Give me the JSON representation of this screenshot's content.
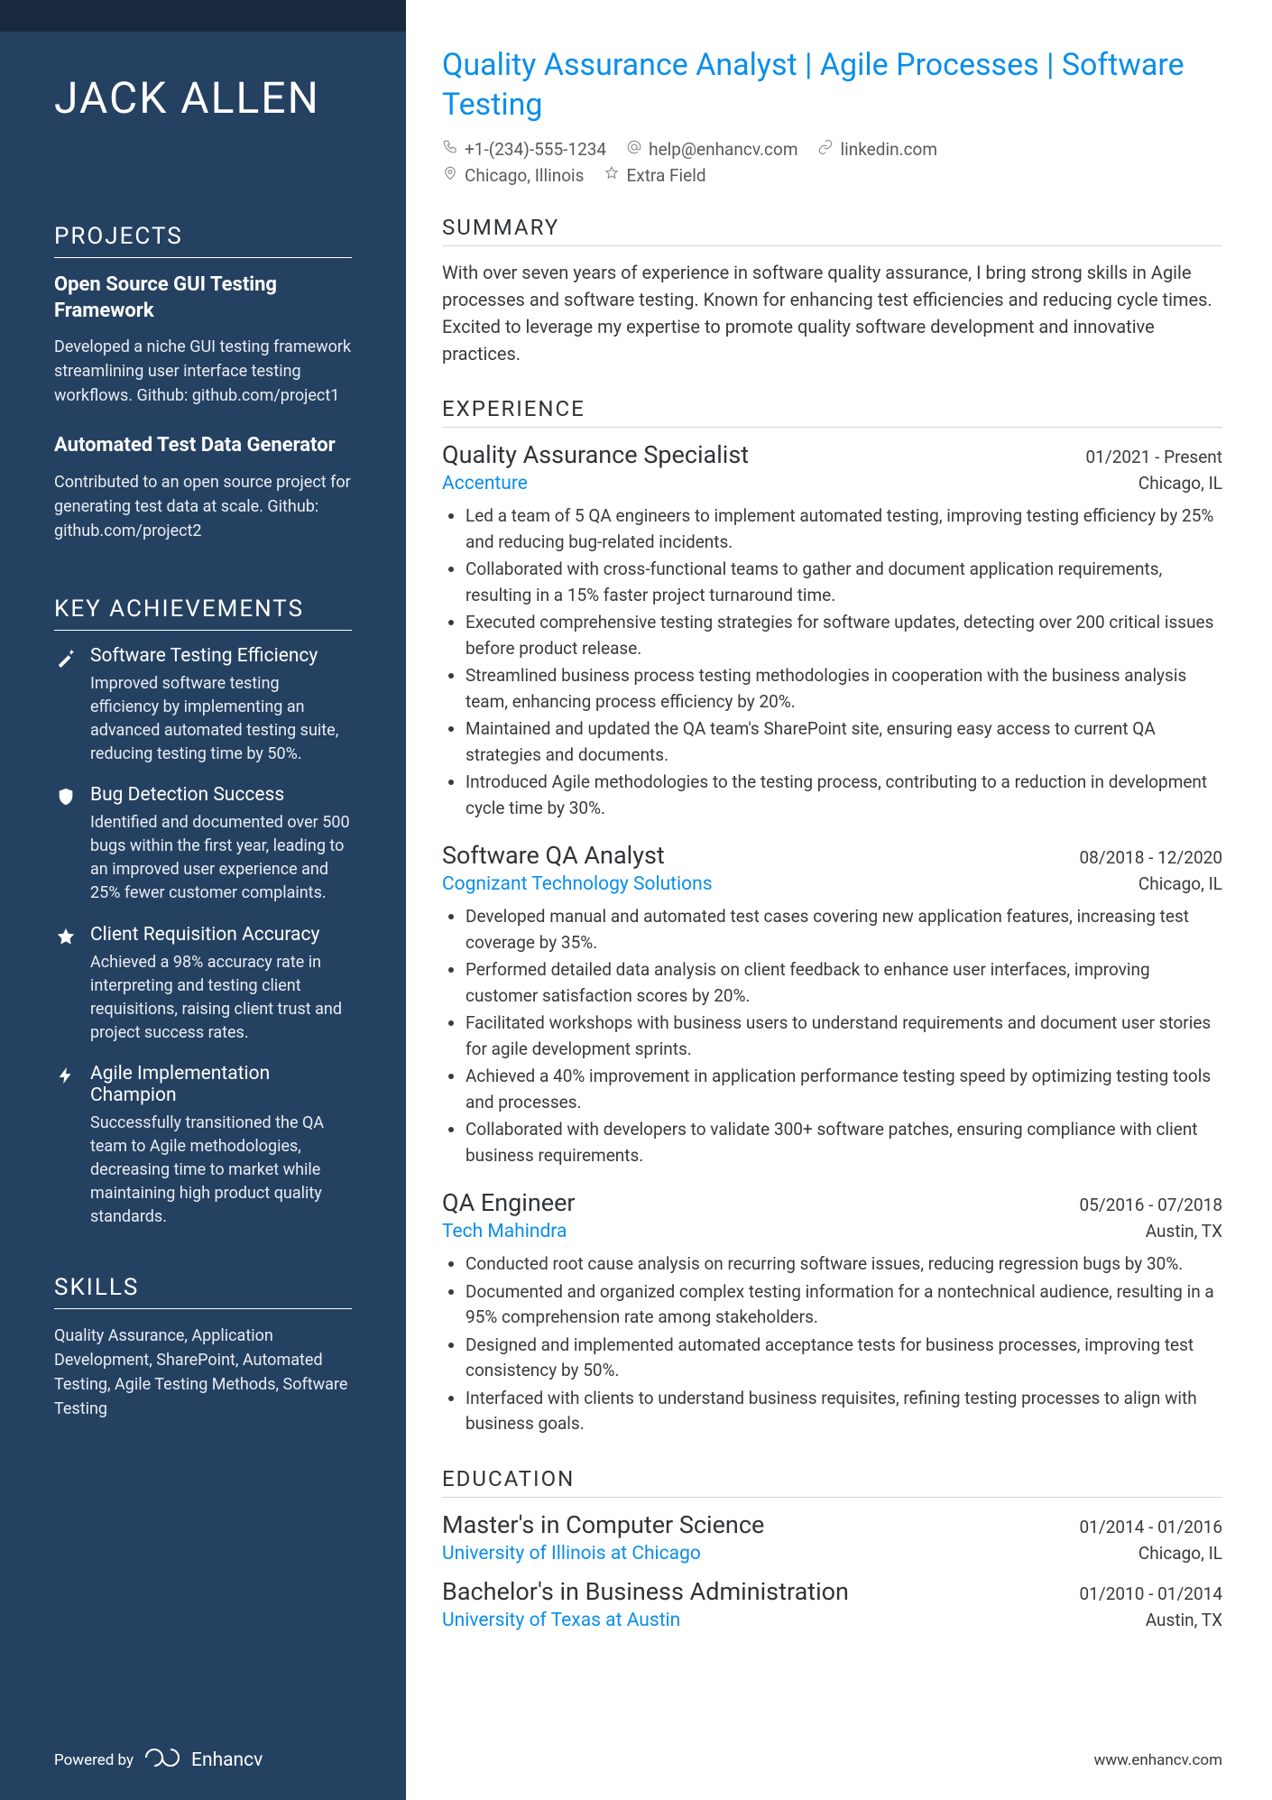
{
  "name": "JACK ALLEN",
  "headline": "Quality Assurance Analyst | Agile Processes | Software Testing",
  "contact": {
    "phone": "+1-(234)-555-1234",
    "email": "help@enhancv.com",
    "linkedin": "linkedin.com",
    "location": "Chicago, Illinois",
    "extra": "Extra Field"
  },
  "sidebar": {
    "projects_title": "PROJECTS",
    "projects": [
      {
        "title": "Open Source GUI Testing Framework",
        "desc": "Developed a niche GUI testing framework streamlining user interface testing workflows. Github: github.com/project1"
      },
      {
        "title": "Automated Test Data Generator",
        "desc": "Contributed to an open source project for generating test data at scale. Github: github.com/project2"
      }
    ],
    "achievements_title": "KEY ACHIEVEMENTS",
    "achievements": [
      {
        "icon": "wand",
        "title": "Software Testing Efficiency",
        "desc": "Improved software testing efficiency by implementing an advanced automated testing suite, reducing testing time by 50%."
      },
      {
        "icon": "shield",
        "title": "Bug Detection Success",
        "desc": "Identified and documented over 500 bugs within the first year, leading to an improved user experience and 25% fewer customer complaints."
      },
      {
        "icon": "star",
        "title": "Client Requisition Accuracy",
        "desc": "Achieved a 98% accuracy rate in interpreting and testing client requisitions, raising client trust and project success rates."
      },
      {
        "icon": "bolt",
        "title": "Agile Implementation Champion",
        "desc": "Successfully transitioned the QA team to Agile methodologies, decreasing time to market while maintaining high product quality standards."
      }
    ],
    "skills_title": "SKILLS",
    "skills": "Quality Assurance, Application Development, SharePoint, Automated Testing, Agile Testing Methods, Software Testing"
  },
  "sections": {
    "summary_title": "SUMMARY",
    "summary": "With over seven years of experience in software quality assurance, I bring strong skills in Agile processes and software testing. Known for enhancing test efficiencies and reducing cycle times. Excited to leverage my expertise to promote quality software development and innovative practices.",
    "experience_title": "EXPERIENCE",
    "experience": [
      {
        "role": "Quality Assurance Specialist",
        "dates": "01/2021 - Present",
        "company": "Accenture",
        "loc": "Chicago, IL",
        "bullets": [
          "Led a team of 5 QA engineers to implement automated testing, improving testing efficiency by 25% and reducing bug-related incidents.",
          "Collaborated with cross-functional teams to gather and document application requirements, resulting in a 15% faster project turnaround time.",
          "Executed comprehensive testing strategies for software updates, detecting over 200 critical issues before product release.",
          "Streamlined business process testing methodologies in cooperation with the business analysis team, enhancing process efficiency by 20%.",
          "Maintained and updated the QA team's SharePoint site, ensuring easy access to current QA strategies and documents.",
          "Introduced Agile methodologies to the testing process, contributing to a reduction in development cycle time by 30%."
        ]
      },
      {
        "role": "Software QA Analyst",
        "dates": "08/2018 - 12/2020",
        "company": "Cognizant Technology Solutions",
        "loc": "Chicago, IL",
        "bullets": [
          "Developed manual and automated test cases covering new application features, increasing test coverage by 35%.",
          "Performed detailed data analysis on client feedback to enhance user interfaces, improving customer satisfaction scores by 20%.",
          "Facilitated workshops with business users to understand requirements and document user stories for agile development sprints.",
          "Achieved a 40% improvement in application performance testing speed by optimizing testing tools and processes.",
          "Collaborated with developers to validate 300+ software patches, ensuring compliance with client business requirements."
        ]
      },
      {
        "role": "QA Engineer",
        "dates": "05/2016 - 07/2018",
        "company": "Tech Mahindra",
        "loc": "Austin, TX",
        "bullets": [
          "Conducted root cause analysis on recurring software issues, reducing regression bugs by 30%.",
          "Documented and organized complex testing information for a nontechnical audience, resulting in a 95% comprehension rate among stakeholders.",
          "Designed and implemented automated acceptance tests for business processes, improving test consistency by 50%.",
          "Interfaced with clients to understand business requisites, refining testing processes to align with business goals."
        ]
      }
    ],
    "education_title": "EDUCATION",
    "education": [
      {
        "degree": "Master's in Computer Science",
        "dates": "01/2014 - 01/2016",
        "school": "University of Illinois at Chicago",
        "loc": "Chicago, IL"
      },
      {
        "degree": "Bachelor's in Business Administration",
        "dates": "01/2010 - 01/2014",
        "school": "University of Texas at Austin",
        "loc": "Austin, TX"
      }
    ]
  },
  "footer": {
    "powered": "Powered by",
    "brand": "Enhancv",
    "url": "www.enhancv.com"
  }
}
